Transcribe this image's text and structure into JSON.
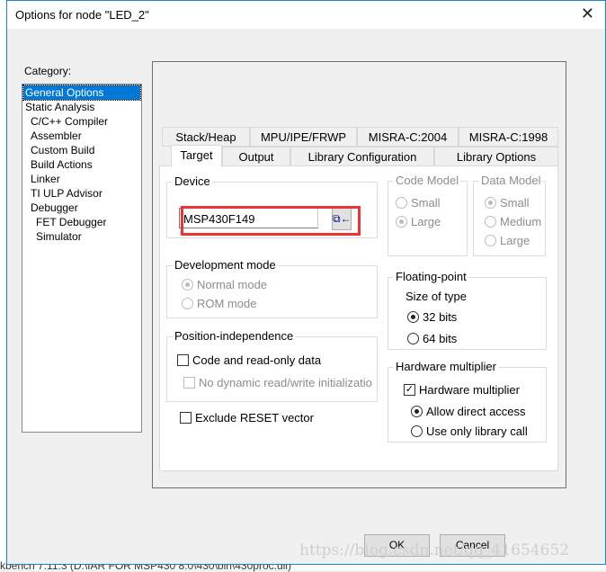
{
  "dialog": {
    "title": "Options for node \"LED_2\""
  },
  "category": {
    "label": "Category:",
    "items": [
      "General Options",
      "Static Analysis",
      "C/C++ Compiler",
      "Assembler",
      "Custom Build",
      "Build Actions",
      "Linker",
      "TI ULP Advisor",
      "Debugger",
      "FET Debugger",
      "Simulator"
    ],
    "selected": "General Options"
  },
  "tabs": {
    "row1": [
      "Stack/Heap",
      "MPU/IPE/FRWP",
      "MISRA-C:2004",
      "MISRA-C:1998"
    ],
    "row2": [
      "Target",
      "Output",
      "Library Configuration",
      "Library Options"
    ],
    "active": "Target"
  },
  "device": {
    "title": "Device",
    "value": "MSP430F149"
  },
  "code_model": {
    "title": "Code Model",
    "options": [
      "Small",
      "Large"
    ],
    "selected": "Large"
  },
  "data_model": {
    "title": "Data Model",
    "options": [
      "Small",
      "Medium",
      "Large"
    ],
    "selected": "Small"
  },
  "dev_mode": {
    "title": "Development mode",
    "options": [
      "Normal mode",
      "ROM mode"
    ],
    "selected": "Normal mode"
  },
  "floating": {
    "title": "Floating-point",
    "size_label": "Size of type",
    "options": [
      "32 bits",
      "64 bits"
    ],
    "selected": "32 bits"
  },
  "position": {
    "title": "Position-independence",
    "code_ro": "Code and read-only data",
    "no_dynamic": "No dynamic read/write initializatio"
  },
  "hw_mult": {
    "title": "Hardware multiplier",
    "checkbox": "Hardware multiplier",
    "checked": true,
    "options": [
      "Allow direct access",
      "Use only library call"
    ],
    "selected": "Allow direct access"
  },
  "exclude_reset": "Exclude RESET vector",
  "buttons": {
    "ok": "OK",
    "cancel": "Cancel"
  },
  "watermark": "https://blog.csdn.net/qq_41654652",
  "background_status": "kbench 7.11.3 (D:\\IAR FOR MSP430 8.0\\430\\bin\\430proc.dll)"
}
